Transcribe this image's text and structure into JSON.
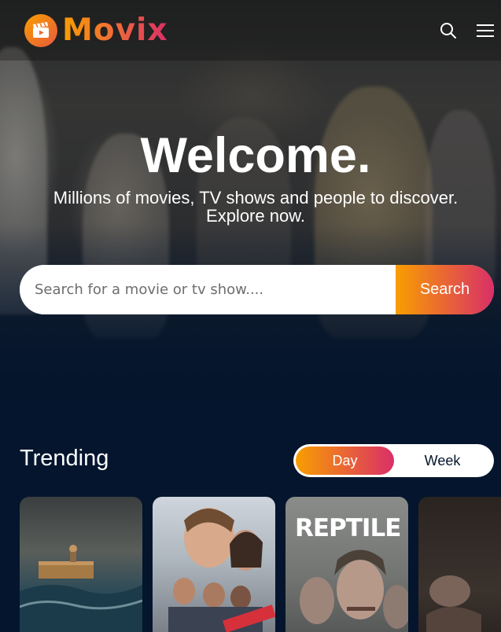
{
  "app": {
    "logo_text": "Movix"
  },
  "hero": {
    "title": "Welcome.",
    "subtitle_line1": "Millions of movies, TV shows and people to discover.",
    "subtitle_line2": "Explore now."
  },
  "search": {
    "placeholder": "Search for a movie or tv show....",
    "value": "",
    "button_label": "Search"
  },
  "trending": {
    "title": "Trending",
    "tabs": [
      {
        "label": "Day",
        "active": true
      },
      {
        "label": "Week",
        "active": false
      }
    ],
    "cards": [
      {
        "poster_text": ""
      },
      {
        "poster_text": ""
      },
      {
        "poster_text": "REPTILE"
      },
      {
        "poster_text": ""
      }
    ]
  },
  "icons": {
    "logo": "film-clapper-icon",
    "search": "search-icon",
    "menu": "hamburger-menu-icon"
  },
  "colors": {
    "background": "#04152d",
    "accent_orange": "#f89e00",
    "accent_pink": "#da2f68",
    "white": "#ffffff"
  }
}
